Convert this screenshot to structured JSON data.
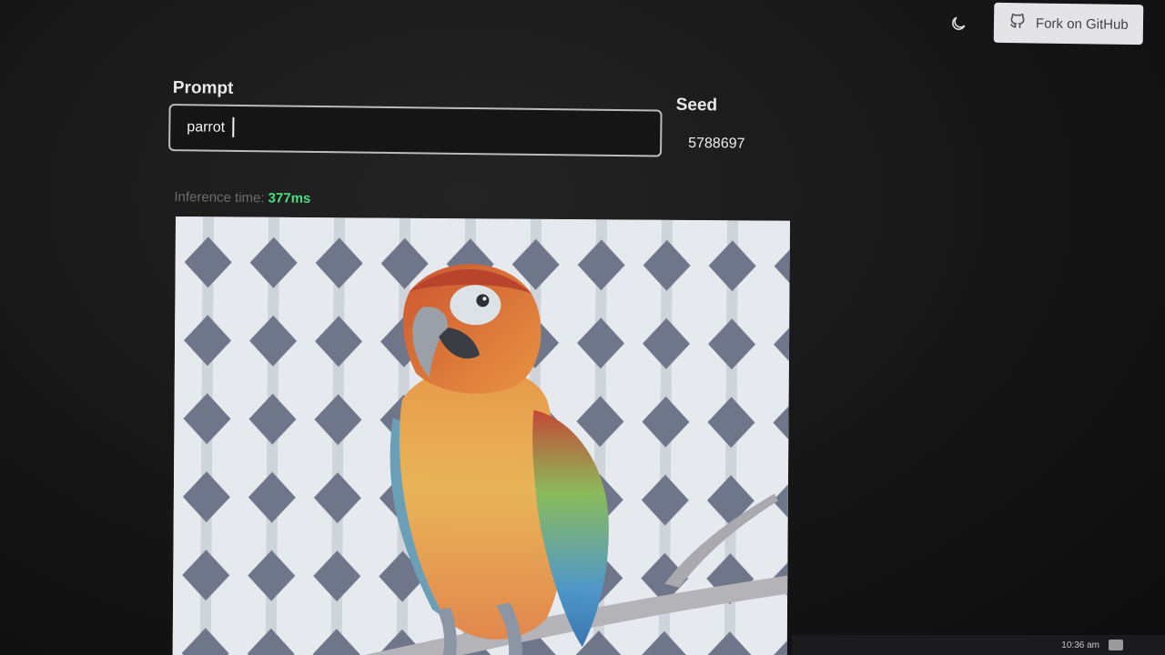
{
  "header": {
    "theme_icon": "theme-toggle-icon",
    "github_icon": "github-icon",
    "fork_label": "Fork on GitHub"
  },
  "form": {
    "prompt_label": "Prompt",
    "prompt_value": "parrot",
    "seed_label": "Seed",
    "seed_value": "5788697"
  },
  "inference": {
    "label": "Inference time:",
    "value": "377ms",
    "value_color": "#4ade80"
  },
  "result": {
    "subject": "generated-parrot-image"
  },
  "taskbar": {
    "clock": "10:36 am"
  }
}
